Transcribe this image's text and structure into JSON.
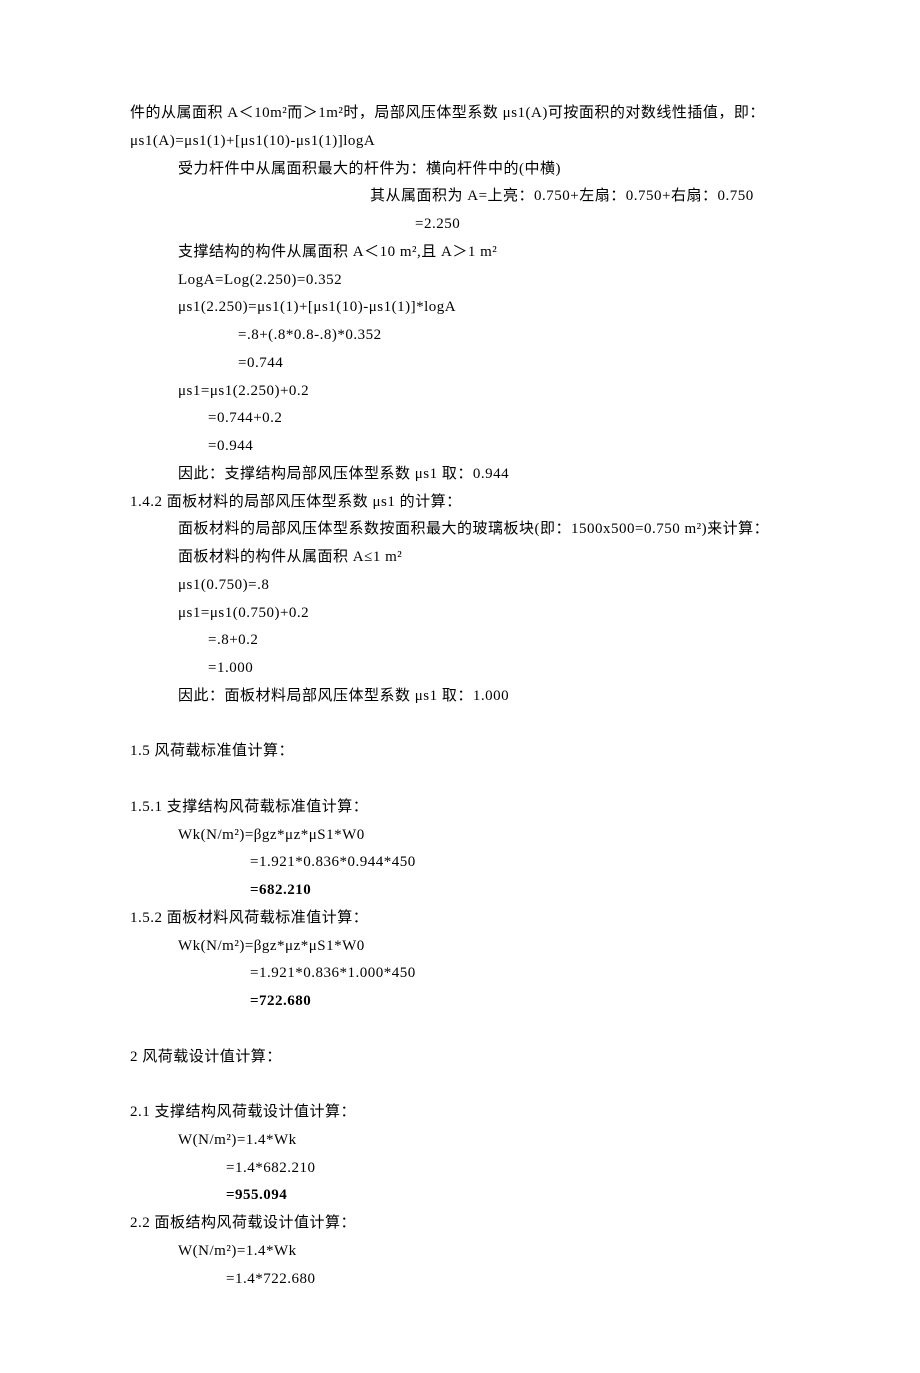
{
  "p0": "件的从属面积 A＜10m²而＞1m²时，局部风压体型系数 μs1(A)可按面积的对数线性插值，即：μs1(A)=μs1(1)+[μs1(10)-μs1(1)]logA",
  "p1": "受力杆件中从属面积最大的杆件为：横向杆件中的(中横)",
  "p2": "其从属面积为 A=上亮：0.750+左扇：0.750+右扇：0.750",
  "p3": "=2.250",
  "p4": "支撑结构的构件从属面积 A＜10 m²,且 A＞1 m²",
  "p5": "LogA=Log(2.250)=0.352",
  "p6": "μs1(2.250)=μs1(1)+[μs1(10)-μs1(1)]*logA",
  "p7": "=.8+(.8*0.8-.8)*0.352",
  "p8": "=0.744",
  "p9": "μs1=μs1(2.250)+0.2",
  "p10": "=0.744+0.2",
  "p11": "=0.944",
  "p12": "因此：支撑结构局部风压体型系数 μs1 取：0.944",
  "p13": "1.4.2 面板材料的局部风压体型系数 μs1 的计算：",
  "p14": "面板材料的局部风压体型系数按面积最大的玻璃板块(即：1500x500=0.750 m²)来计算：",
  "p15": "面板材料的构件从属面积 A≤1 m²",
  "p16": "μs1(0.750)=.8",
  "p17": "μs1=μs1(0.750)+0.2",
  "p18": "=.8+0.2",
  "p19": "=1.000",
  "p20": "因此：面板材料局部风压体型系数 μs1 取：1.000",
  "p21": "1.5 风荷载标准值计算：",
  "p22": "1.5.1 支撑结构风荷载标准值计算：",
  "p23": "Wk(N/m²)=βgz*μz*μS1*W0",
  "p24": "=1.921*0.836*0.944*450",
  "p25": "=682.210",
  "p26": "1.5.2 面板材料风荷载标准值计算：",
  "p27": "Wk(N/m²)=βgz*μz*μS1*W0",
  "p28": "=1.921*0.836*1.000*450",
  "p29": "=722.680",
  "p30": "2   风荷载设计值计算：",
  "p31": "2.1 支撑结构风荷载设计值计算：",
  "p32": "W(N/m²)=1.4*Wk",
  "p33": "=1.4*682.210",
  "p34": "=955.094",
  "p35": "2.2 面板结构风荷载设计值计算：",
  "p36": "W(N/m²)=1.4*Wk",
  "p37": "=1.4*722.680"
}
